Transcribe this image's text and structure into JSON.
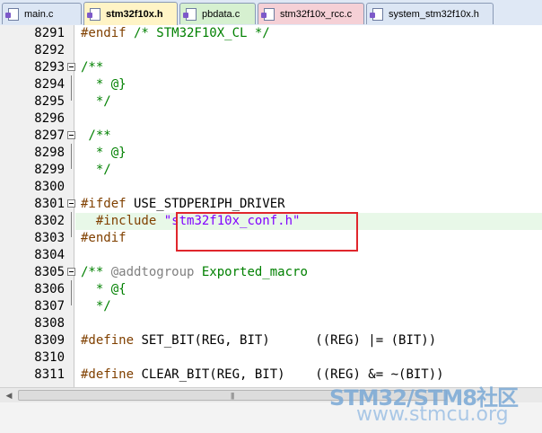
{
  "tabs": [
    {
      "label": "main.c",
      "active": false,
      "color": "#dce6f4"
    },
    {
      "label": "stm32f10x.h",
      "active": true,
      "color": "#fff4c6"
    },
    {
      "label": "pbdata.c",
      "active": false,
      "color": "#d6f0d0"
    },
    {
      "label": "stm32f10x_rcc.c",
      "active": false,
      "color": "#f5d0d6"
    },
    {
      "label": "system_stm32f10x.h",
      "active": false,
      "color": "#dce6f4"
    }
  ],
  "lines": [
    {
      "num": "8291"
    },
    {
      "num": "8292"
    },
    {
      "num": "8293"
    },
    {
      "num": "8294"
    },
    {
      "num": "8295"
    },
    {
      "num": "8296"
    },
    {
      "num": "8297"
    },
    {
      "num": "8298"
    },
    {
      "num": "8299"
    },
    {
      "num": "8300"
    },
    {
      "num": "8301"
    },
    {
      "num": "8302"
    },
    {
      "num": "8303"
    },
    {
      "num": "8304"
    },
    {
      "num": "8305"
    },
    {
      "num": "8306"
    },
    {
      "num": "8307"
    },
    {
      "num": "8308"
    },
    {
      "num": "8309"
    },
    {
      "num": "8310"
    },
    {
      "num": "8311"
    }
  ],
  "code": {
    "l8291_kw": "#endif",
    "l8291_cm": " /* STM32F10X_CL */",
    "l8293": "/**",
    "l8294": "  * @}",
    "l8295": "  */",
    "l8297": " /**",
    "l8298": "  * @}",
    "l8299": "  */",
    "l8301_kw": "#ifdef",
    "l8301_id": " USE_STDPERIPH_DRIVER",
    "l8302_kw": "  #include",
    "l8302_str": "\"stm32f10x_conf.h\"",
    "l8303": "#endif",
    "l8305_cm": "/** ",
    "l8305_tag": "@addtogroup",
    "l8305_rest": " Exported_macro",
    "l8306": "  * @{",
    "l8307": "  */",
    "l8309_kw": "#define",
    "l8309_rest": " SET_BIT(REG, BIT)      ((REG) |= (BIT))",
    "l8311_kw": "#define",
    "l8311_rest": " CLEAR_BIT(REG, BIT)    ((REG) &= ~(BIT))"
  },
  "scroll": {
    "grip": "|||"
  },
  "watermark": {
    "line1": "STM32/STM8社区",
    "line2": "www.stmcu.org"
  },
  "colors": {
    "highlight_box": "#e0262c",
    "keyword": "#0000ff",
    "comment": "#008000"
  }
}
